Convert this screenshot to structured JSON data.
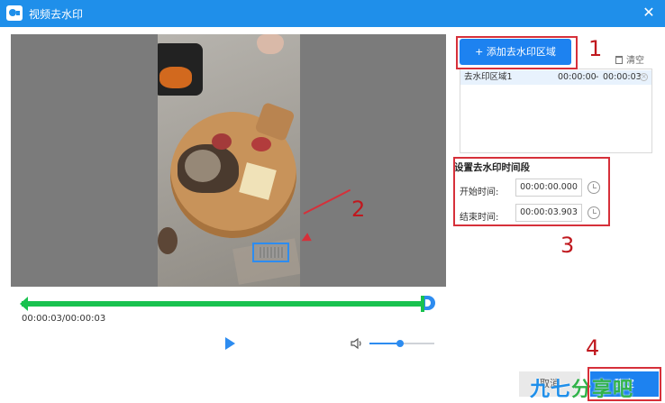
{
  "window": {
    "title": "视频去水印",
    "close_label": "✕"
  },
  "player": {
    "time_display": "00:00:03/00:00:03",
    "trim_start_fraction": 0,
    "trim_end_fraction": 1,
    "volume_fraction": 0.47,
    "play_icon": "play-icon",
    "volume_icon": "speaker-icon"
  },
  "regions": {
    "add_button_label": "+ 添加去水印区域",
    "clear_label": "清空",
    "items": [
      {
        "name": "去水印区域1",
        "start": "00:00:00",
        "separator": "-",
        "end": "00:00:03"
      }
    ]
  },
  "time_period": {
    "title": "设置去水印时间段",
    "start_label": "开始时间:",
    "start_value": "00:00:00.000",
    "end_label": "结束时间:",
    "end_value": "00:00:03.903"
  },
  "buttons": {
    "cancel": "取消",
    "confirm": "确定"
  },
  "annotations": [
    "1",
    "2",
    "3",
    "4"
  ],
  "logo": {
    "part1": "九七",
    "part2": "分享吧"
  },
  "colors": {
    "accent": "#1d82f0",
    "timeline": "#19c24f",
    "annotation": "#d6303a"
  }
}
